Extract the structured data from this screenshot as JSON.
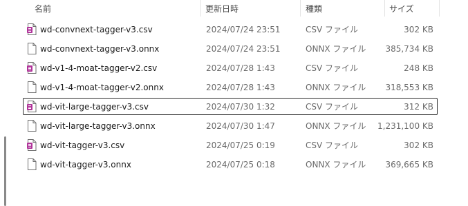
{
  "columns": {
    "name": "名前",
    "date": "更新日時",
    "type": "種類",
    "size": "サイズ"
  },
  "files": [
    {
      "name": "wd-convnext-tagger-v3.csv",
      "date": "2024/07/24 23:51",
      "type": "CSV ファイル",
      "size": "302 KB",
      "icon": "csv-file-icon"
    },
    {
      "name": "wd-convnext-tagger-v3.onnx",
      "date": "2024/07/24 23:51",
      "type": "ONNX ファイル",
      "size": "385,734 KB",
      "icon": "file-icon"
    },
    {
      "name": "wd-v1-4-moat-tagger-v2.csv",
      "date": "2024/07/28 1:43",
      "type": "CSV ファイル",
      "size": "248 KB",
      "icon": "csv-file-icon"
    },
    {
      "name": "wd-v1-4-moat-tagger-v2.onnx",
      "date": "2024/07/28 1:43",
      "type": "ONNX ファイル",
      "size": "318,553 KB",
      "icon": "file-icon"
    },
    {
      "name": "wd-vit-large-tagger-v3.csv",
      "date": "2024/07/30 1:32",
      "type": "CSV ファイル",
      "size": "312 KB",
      "icon": "csv-file-icon",
      "focused": true
    },
    {
      "name": "wd-vit-large-tagger-v3.onnx",
      "date": "2024/07/30 1:47",
      "type": "ONNX ファイル",
      "size": "1,231,100 KB",
      "icon": "file-icon"
    },
    {
      "name": "wd-vit-tagger-v3.csv",
      "date": "2024/07/25 0:19",
      "type": "CSV ファイル",
      "size": "302 KB",
      "icon": "csv-file-icon"
    },
    {
      "name": "wd-vit-tagger-v3.onnx",
      "date": "2024/07/25 0:18",
      "type": "ONNX ファイル",
      "size": "369,665 KB",
      "icon": "file-icon"
    }
  ],
  "colors": {
    "csv_icon_accent": "#b0359a",
    "focus_border": "#2b2b2b"
  }
}
